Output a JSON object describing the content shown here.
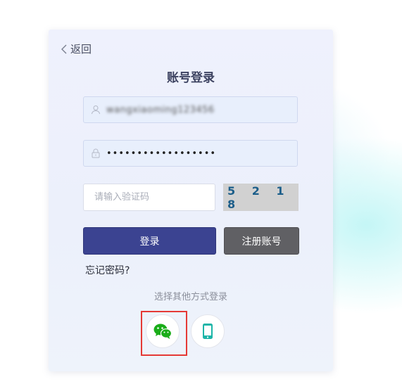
{
  "nav": {
    "back_label": "返回"
  },
  "title": "账号登录",
  "username": {
    "value": "wangxiaoming123456"
  },
  "password": {
    "value": "••••••••••••••••••"
  },
  "captcha": {
    "placeholder": "请输入验证码",
    "code": "5 2 1 8"
  },
  "buttons": {
    "login": "登录",
    "register": "注册账号"
  },
  "forgot_link": "忘记密码?",
  "other_login": {
    "label": "选择其他方式登录",
    "methods": [
      {
        "icon": "wechat-icon",
        "color": "#1aad19"
      },
      {
        "icon": "mobile-phone-icon",
        "color": "#1cb5a8"
      }
    ]
  },
  "colors": {
    "primary": "#3b4391",
    "secondary": "#606064",
    "highlight": "#e53935"
  }
}
